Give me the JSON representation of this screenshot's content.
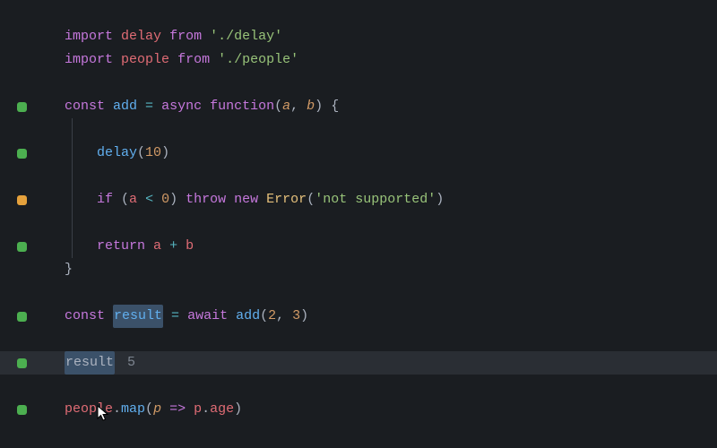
{
  "code": {
    "l1": {
      "import": "import",
      "name": "delay",
      "from": "from",
      "path": "'./delay'"
    },
    "l2": {
      "import": "import",
      "name": "people",
      "from": "from",
      "path": "'./people'"
    },
    "l4": {
      "const": "const",
      "name": "add",
      "eq": " = ",
      "async": "async",
      "function": "function",
      "params_open": "(",
      "p1": "a",
      "comma": ", ",
      "p2": "b",
      "params_close": ")",
      "brace": " {"
    },
    "l6": {
      "call": "delay",
      "open": "(",
      "arg": "10",
      "close": ")"
    },
    "l8": {
      "if": "if",
      "open": " (",
      "a": "a",
      "lt": " < ",
      "zero": "0",
      "close": ") ",
      "throw": "throw",
      "new": "new",
      "err": "Error",
      "eopen": "(",
      "msg": "'not supported'",
      "eclose": ")"
    },
    "l10": {
      "return": "return",
      "a": "a",
      "plus": " + ",
      "b": "b"
    },
    "l11": {
      "brace": "}"
    },
    "l13": {
      "const": "const",
      "name": "result",
      "eq": " = ",
      "await": "await",
      "call": "add",
      "open": "(",
      "a1": "2",
      "comma": ", ",
      "a2": "3",
      "close": ")"
    },
    "l15": {
      "name": "result",
      "value": "5"
    },
    "l17": {
      "obj": "people",
      "dot": ".",
      "method": "map",
      "open": "(",
      "p": "p",
      "arrow": " => ",
      "p2": "p",
      "dot2": ".",
      "prop": "age",
      "close": ")"
    }
  },
  "gutter": {
    "green": "covered",
    "amber": "partial"
  }
}
